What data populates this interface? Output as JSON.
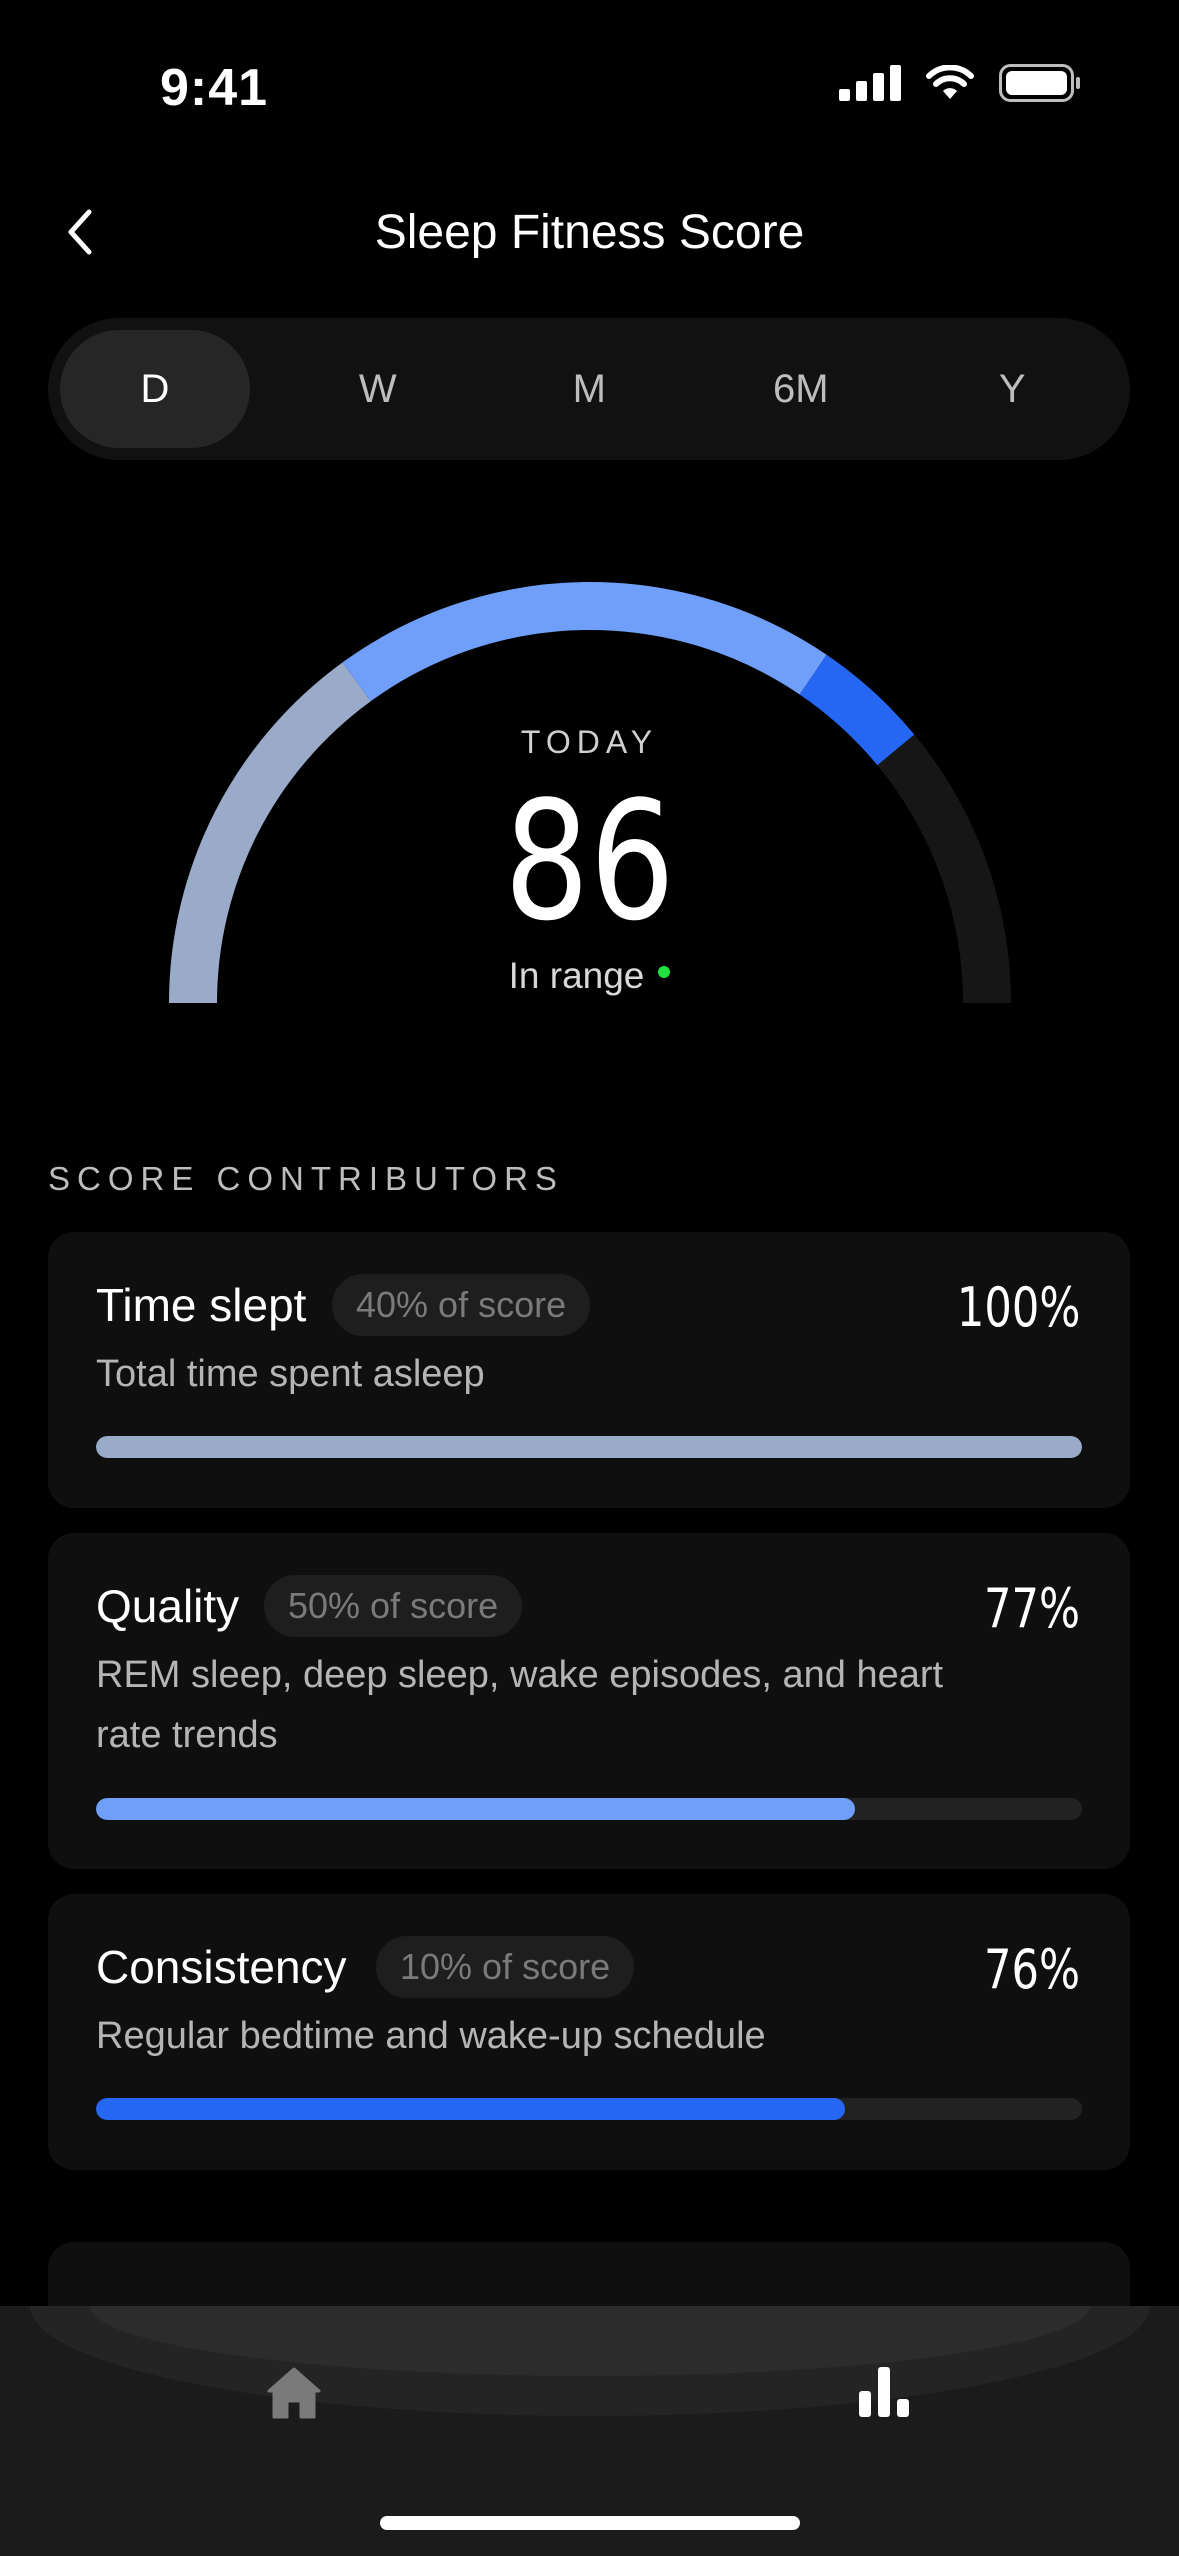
{
  "status_bar": {
    "time": "9:41"
  },
  "header": {
    "title": "Sleep Fitness Score"
  },
  "range_tabs": [
    "D",
    "W",
    "M",
    "6M",
    "Y"
  ],
  "selected_range": "D",
  "gauge": {
    "label": "TODAY",
    "score": "86",
    "status": "In range",
    "score_value": 86,
    "segments": [
      {
        "from": 0,
        "to": 30,
        "color": "#9aabc9"
      },
      {
        "from": 30,
        "to": 69,
        "color": "#6f9ff8"
      },
      {
        "from": 69,
        "to": 78,
        "color": "#2566f2"
      },
      {
        "from": 78,
        "to": 100,
        "color": "#161616"
      }
    ]
  },
  "section": {
    "label": "SCORE CONTRIBUTORS"
  },
  "contributors": [
    {
      "title": "Time slept",
      "weight": "40% of score",
      "percent_label": "100%",
      "description": "Total time spent asleep",
      "value": 100,
      "color": "#9aabc9"
    },
    {
      "title": "Quality",
      "weight": "50% of score",
      "percent_label": "77%",
      "description": "REM sleep, deep sleep, wake episodes, and heart rate trends",
      "value": 77,
      "color": "#6f9ff8"
    },
    {
      "title": "Consistency",
      "weight": "10% of score",
      "percent_label": "76%",
      "description": "Regular bedtime and wake-up schedule",
      "value": 76,
      "color": "#2566f2"
    }
  ],
  "tabbar": {
    "items": [
      "home-icon",
      "bar-chart-icon"
    ],
    "active": "bar-chart-icon"
  }
}
